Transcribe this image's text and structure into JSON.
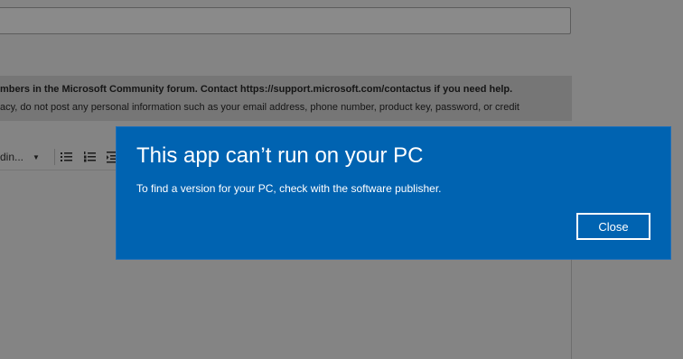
{
  "form": {
    "title_value": ""
  },
  "notice": {
    "line1": "mbers in the Microsoft Community forum. Contact https://support.microsoft.com/contactus if you need help.",
    "line2": "acy, do not post any personal information such as your email address, phone number, product key, password, or credit"
  },
  "toolbar": {
    "format_label": "din...",
    "format_arrow_icon": "caret-down-icon",
    "icons": [
      "bullet-list-icon",
      "numbered-list-icon",
      "indent-icon"
    ]
  },
  "dialog": {
    "title": "This app can’t run on your PC",
    "message": "To find a version for your PC, check with the software publisher.",
    "close_label": "Close",
    "accent_color": "#0063b1"
  }
}
